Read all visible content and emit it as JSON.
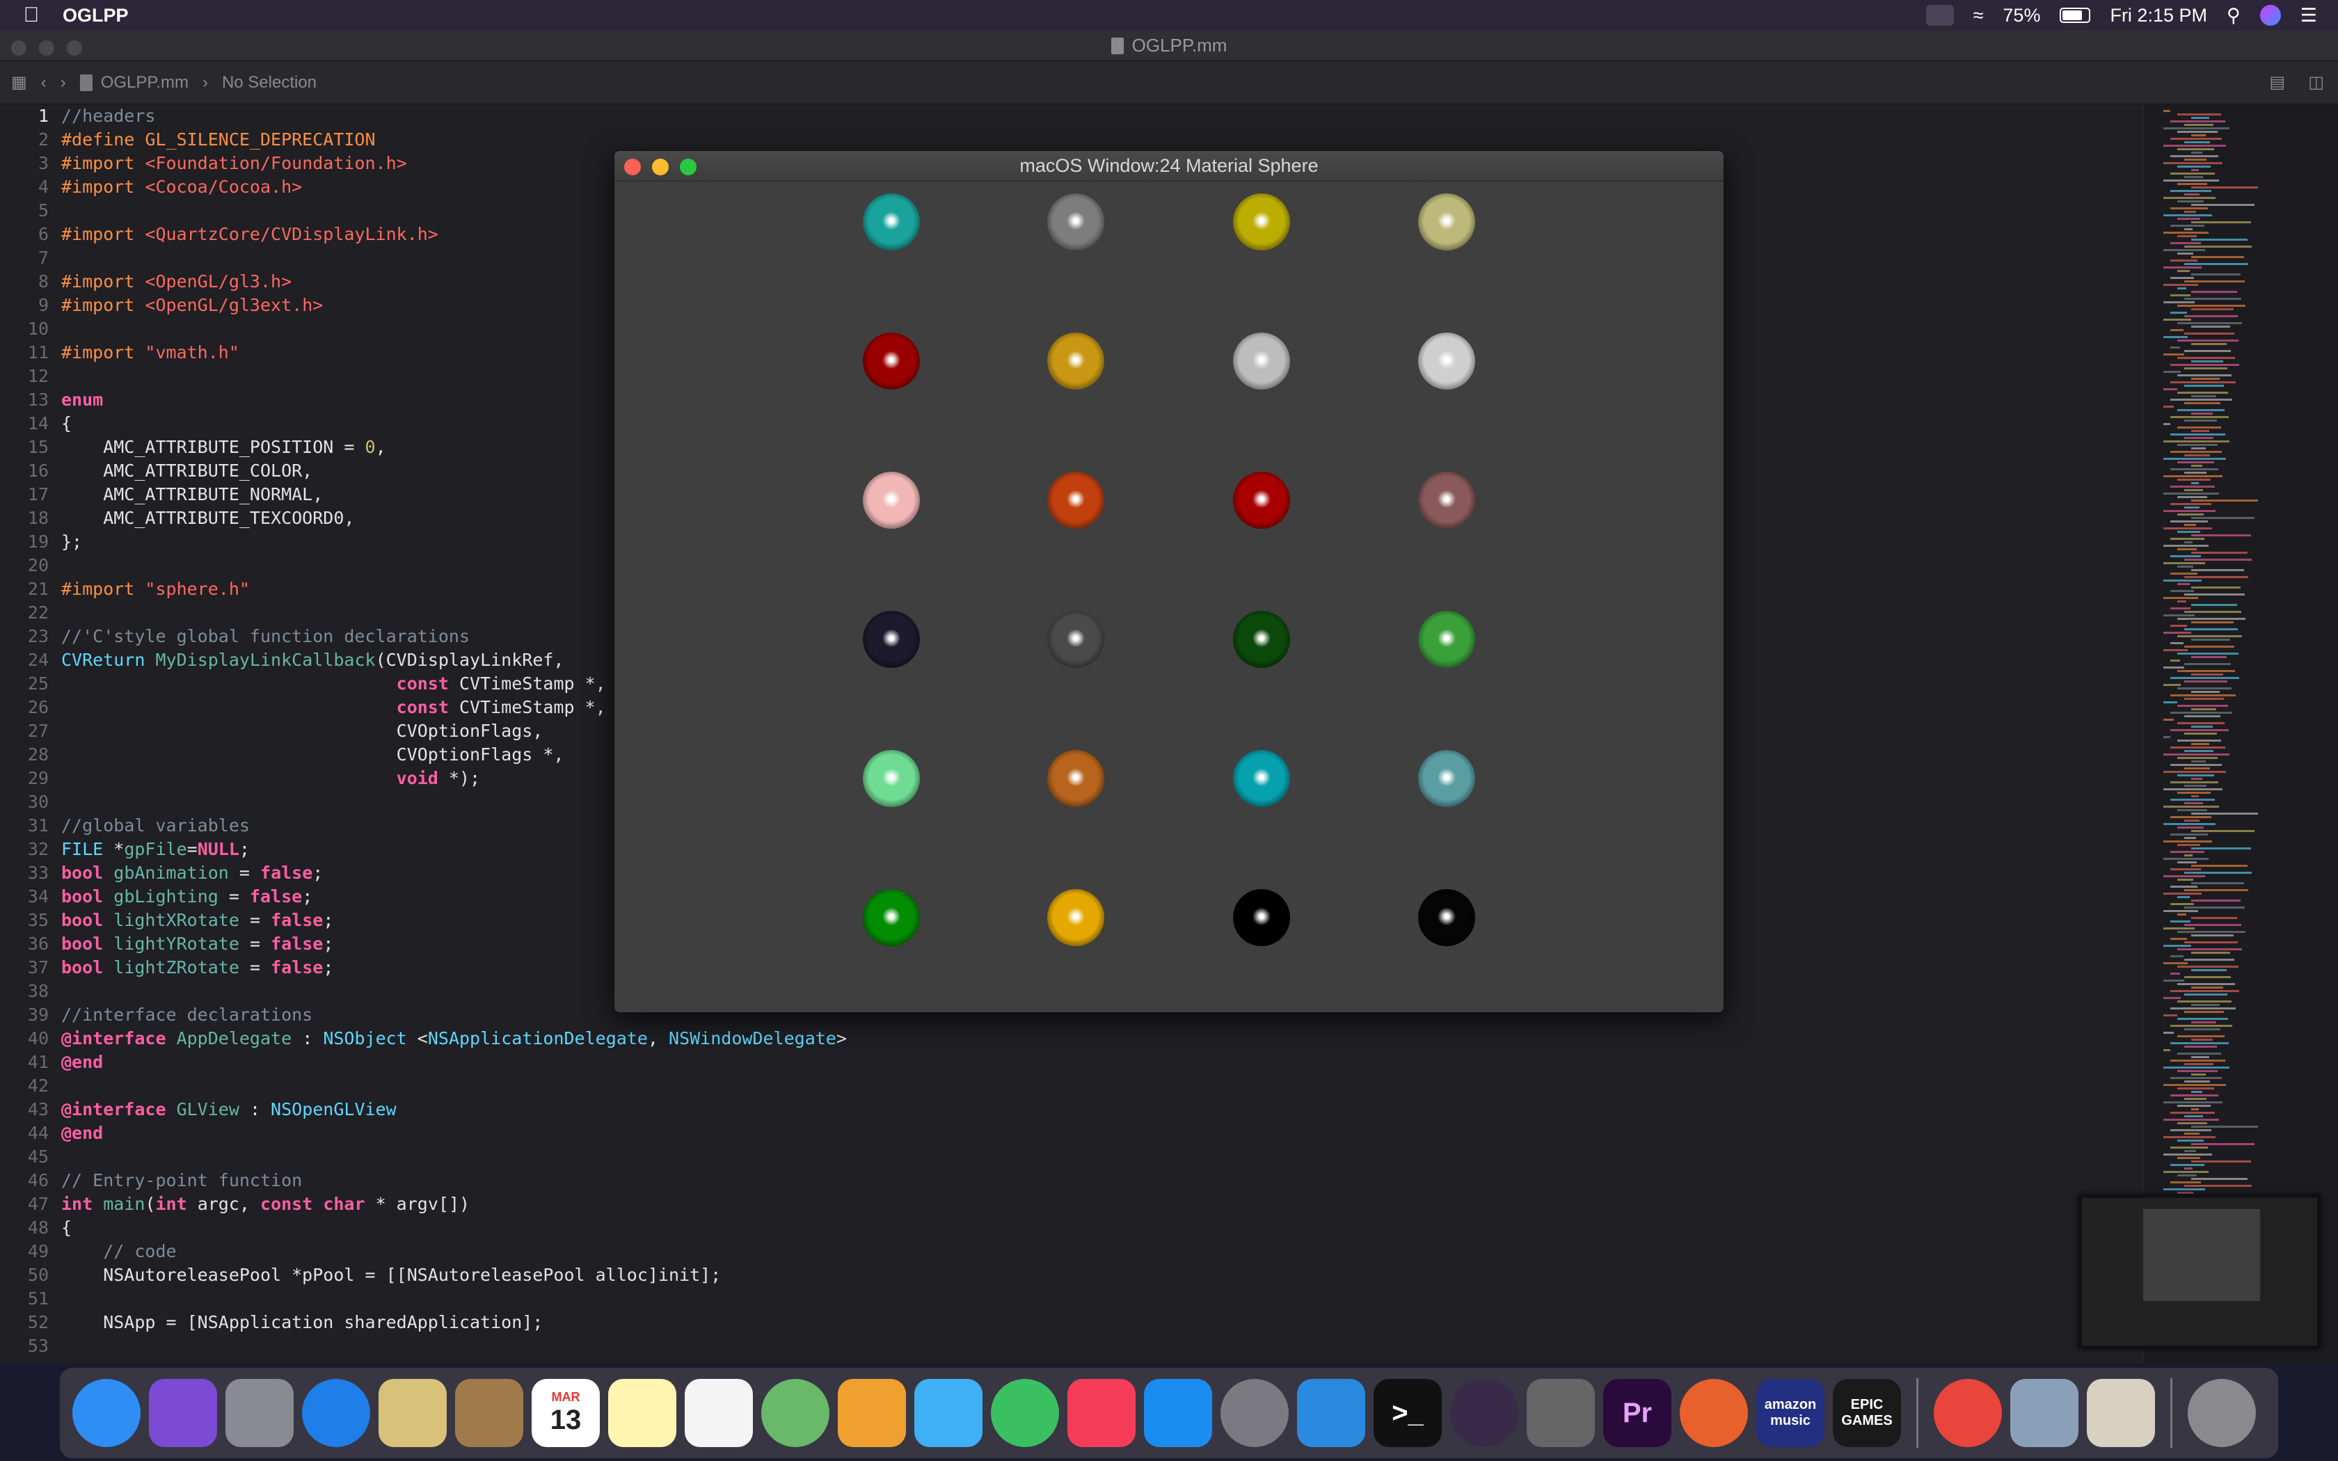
{
  "menubar": {
    "app_name": "OGLPP",
    "battery": "75%",
    "clock": "Fri 2:15 PM",
    "icons": [
      "apple-icon",
      "creative-cloud-icon",
      "wifi-icon",
      "battery-icon",
      "search-icon",
      "siri-icon",
      "control-center-icon"
    ]
  },
  "xcode": {
    "window_title": "OGLPP.mm",
    "breadcrumb_file": "OGLPP.mm",
    "breadcrumb_selection": "No Selection"
  },
  "code_lines": [
    {
      "n": "1",
      "html": "<span class='cm'>//headers</span>"
    },
    {
      "n": "2",
      "html": "<span class='pp'>#define GL_SILENCE_DEPRECATION</span>"
    },
    {
      "n": "3",
      "html": "<span class='pp'>#import </span><span class='str'>&lt;Foundation/Foundation.h&gt;</span>"
    },
    {
      "n": "4",
      "html": "<span class='pp'>#import </span><span class='str'>&lt;Cocoa/Cocoa.h&gt;</span>"
    },
    {
      "n": "5",
      "html": ""
    },
    {
      "n": "6",
      "html": "<span class='pp'>#import </span><span class='str'>&lt;QuartzCore/CVDisplayLink.h&gt;</span>"
    },
    {
      "n": "7",
      "html": ""
    },
    {
      "n": "8",
      "html": "<span class='pp'>#import </span><span class='str'>&lt;OpenGL/gl3.h&gt;</span>"
    },
    {
      "n": "9",
      "html": "<span class='pp'>#import </span><span class='str'>&lt;OpenGL/gl3ext.h&gt;</span>"
    },
    {
      "n": "10",
      "html": ""
    },
    {
      "n": "11",
      "html": "<span class='pp'>#import </span><span class='str'>\"vmath.h\"</span>"
    },
    {
      "n": "12",
      "html": ""
    },
    {
      "n": "13",
      "html": "<span class='k'>enum</span>"
    },
    {
      "n": "14",
      "html": "{"
    },
    {
      "n": "15",
      "html": "    AMC_ATTRIBUTE_POSITION = <span class='num'>0</span>,"
    },
    {
      "n": "16",
      "html": "    AMC_ATTRIBUTE_COLOR,"
    },
    {
      "n": "17",
      "html": "    AMC_ATTRIBUTE_NORMAL,"
    },
    {
      "n": "18",
      "html": "    AMC_ATTRIBUTE_TEXCOORD0,"
    },
    {
      "n": "19",
      "html": "};"
    },
    {
      "n": "20",
      "html": ""
    },
    {
      "n": "21",
      "html": "<span class='pp'>#import </span><span class='str'>\"sphere.h\"</span>"
    },
    {
      "n": "22",
      "html": ""
    },
    {
      "n": "23",
      "html": "<span class='cm'>//'C'style global function declarations</span>"
    },
    {
      "n": "24",
      "html": "<span class='ty'>CVReturn</span> <span class='fn'>MyDisplayLinkCallback</span>(CVDisplayLinkRef,"
    },
    {
      "n": "25",
      "html": "                                <span class='k'>const</span> CVTimeStamp *,"
    },
    {
      "n": "26",
      "html": "                                <span class='k'>const</span> CVTimeStamp *,"
    },
    {
      "n": "27",
      "html": "                                CVOptionFlags,"
    },
    {
      "n": "28",
      "html": "                                CVOptionFlags *,"
    },
    {
      "n": "29",
      "html": "                                <span class='k'>void</span> *);"
    },
    {
      "n": "30",
      "html": ""
    },
    {
      "n": "31",
      "html": "<span class='cm'>//global variables</span>"
    },
    {
      "n": "32",
      "html": "<span class='ty'>FILE</span> *<span class='fn'>gpFile</span>=<span class='k'>NULL</span>;"
    },
    {
      "n": "33",
      "html": "<span class='k'>bool</span> <span class='fn'>gbAnimation</span> = <span class='k'>false</span>;"
    },
    {
      "n": "34",
      "html": "<span class='k'>bool</span> <span class='fn'>gbLighting</span> = <span class='k'>false</span>;"
    },
    {
      "n": "35",
      "html": "<span class='k'>bool</span> <span class='fn'>lightXRotate</span> = <span class='k'>false</span>;"
    },
    {
      "n": "36",
      "html": "<span class='k'>bool</span> <span class='fn'>lightYRotate</span> = <span class='k'>false</span>;"
    },
    {
      "n": "37",
      "html": "<span class='k'>bool</span> <span class='fn'>lightZRotate</span> = <span class='k'>false</span>;"
    },
    {
      "n": "38",
      "html": ""
    },
    {
      "n": "39",
      "html": "<span class='cm'>//interface declarations</span>"
    },
    {
      "n": "40",
      "html": "<span class='k'>@interface</span> <span class='fn'>AppDelegate</span> : <span class='ty'>NSObject</span> &lt;<span class='ty'>NSApplicationDelegate</span>, <span class='ty'>NSWindowDelegate</span>&gt;"
    },
    {
      "n": "41",
      "html": "<span class='k'>@end</span>"
    },
    {
      "n": "42",
      "html": ""
    },
    {
      "n": "43",
      "html": "<span class='k'>@interface</span> <span class='fn'>GLView</span> : <span class='ty'>NSOpenGLView</span>"
    },
    {
      "n": "44",
      "html": "<span class='k'>@end</span>"
    },
    {
      "n": "45",
      "html": ""
    },
    {
      "n": "46",
      "html": "<span class='cm'>// Entry-point function</span>"
    },
    {
      "n": "47",
      "html": "<span class='k'>int</span> <span class='fn'>main</span>(<span class='k'>int</span> argc, <span class='k'>const char</span> * argv[])"
    },
    {
      "n": "48",
      "html": "{"
    },
    {
      "n": "49",
      "html": "    <span class='cm'>// code</span>"
    },
    {
      "n": "50",
      "html": "    NSAutoreleasePool *pPool = [[NSAutoreleasePool alloc]init];"
    },
    {
      "n": "51",
      "html": ""
    },
    {
      "n": "52",
      "html": "    NSApp = [NSApplication sharedApplication];"
    },
    {
      "n": "53",
      "html": ""
    }
  ],
  "gl_window": {
    "title": "macOS Window:24 Material Sphere",
    "spheres": [
      [
        "#1aa39c",
        "#7d7d7d",
        "#bcae00",
        "#bdb97a"
      ],
      [
        "#9a0000",
        "#c89814",
        "#bdbdbd",
        "#cfcfcf"
      ],
      [
        "#f0b7b5",
        "#c2400e",
        "#a80000",
        "#8a5a5a"
      ],
      [
        "#1c1a2c",
        "#4a4a4a",
        "#0b4a0b",
        "#3aa03a"
      ],
      [
        "#6edc92",
        "#b8641c",
        "#06a0ae",
        "#5a9ea4"
      ],
      [
        "#028d02",
        "#e4a800",
        "#000000",
        "#050505"
      ]
    ]
  },
  "dock": {
    "apps": [
      {
        "name": "finder-icon",
        "label": "",
        "color": "#2e8ef4"
      },
      {
        "name": "siri-app-icon",
        "label": "",
        "color": "#7b4bd3"
      },
      {
        "name": "launchpad-icon",
        "label": "",
        "color": "#8a8a92"
      },
      {
        "name": "safari-icon",
        "label": "",
        "color": "#1f7ee8"
      },
      {
        "name": "mail-icon",
        "label": "",
        "color": "#d8c27a"
      },
      {
        "name": "contacts-icon",
        "label": "",
        "color": "#a07a4a"
      },
      {
        "name": "calendar-icon",
        "label": "13",
        "month": "MAR",
        "color": "#ffffff"
      },
      {
        "name": "notes-icon",
        "label": "",
        "color": "#fff4b0"
      },
      {
        "name": "reminders-icon",
        "label": "",
        "color": "#f4f4f4"
      },
      {
        "name": "maps-icon",
        "label": "",
        "color": "#6ab86a"
      },
      {
        "name": "photos-icon",
        "label": "",
        "color": "#f0a030"
      },
      {
        "name": "messages-icon",
        "label": "",
        "color": "#3fb0f5"
      },
      {
        "name": "facetime-icon",
        "label": "",
        "color": "#3ac060"
      },
      {
        "name": "music-icon",
        "label": "",
        "color": "#f53d5a"
      },
      {
        "name": "app-store-icon",
        "label": "",
        "color": "#1a8cf0"
      },
      {
        "name": "system-preferences-icon",
        "label": "",
        "color": "#7a7a80"
      },
      {
        "name": "xcode-icon",
        "label": "",
        "color": "#2a8ae0"
      },
      {
        "name": "terminal-icon",
        "label": ">_",
        "color": "#111111"
      },
      {
        "name": "final-cut-icon",
        "label": "",
        "color": "#3a2a4a"
      },
      {
        "name": "disk-utility-icon",
        "label": "",
        "color": "#666666"
      },
      {
        "name": "premiere-pro-icon",
        "label": "Pr",
        "color": "#2a0a3a"
      },
      {
        "name": "firefox-icon",
        "label": "",
        "color": "#e8602c"
      },
      {
        "name": "amazon-music-icon",
        "label": "amazon music",
        "color": "#232f80"
      },
      {
        "name": "epic-games-icon",
        "label": "EPIC GAMES",
        "color": "#1a1a1a"
      },
      {
        "name": "anydesk-icon",
        "label": "",
        "color": "#e8453c"
      },
      {
        "name": "preview-icon",
        "label": "",
        "color": "#8aa0b8"
      },
      {
        "name": "instruments-icon",
        "label": "",
        "color": "#d8d0c0"
      },
      {
        "name": "trash-icon",
        "label": "",
        "color": "#8a8a8e"
      }
    ]
  }
}
